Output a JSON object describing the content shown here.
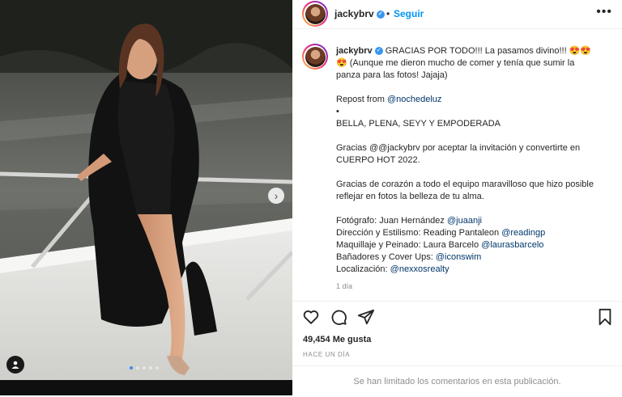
{
  "post": {
    "username": "jackybrv",
    "follow_label": "Seguir",
    "more_label": "•••",
    "verified_mark": "✓",
    "caption_lines": [
      "GRACIAS POR TODO!!! La pasamos divino!!! 😍😍",
      "😍 (Aunque me dieron mucho de comer y tenía que sumir la",
      "panza para las fotos! Jajaja)"
    ],
    "repost_prefix": "Repost from ",
    "repost_mention": "@nochedeluz",
    "bullet": "•",
    "tagline": "BELLA, PLENA, SEYY  Y EMPODERADA",
    "thanks_prefix": "Gracias @",
    "thanks_mention": "@jackybrv",
    "thanks_rest_1": " por aceptar la invitación y convertirte en",
    "thanks_rest_2": "CUERPO HOT 2022.",
    "team_line_1": "Gracias de corazón a todo el equipo maravilloso que hizo posible",
    "team_line_2": "reflejar en fotos la belleza de tu alma.",
    "credits": [
      {
        "label": "Fotógrafo: Juan Hernández ",
        "mention": "@juaanji"
      },
      {
        "label": "Dirección y Estilismo: Reading Pantaleon ",
        "mention": "@readingp"
      },
      {
        "label": "Maquillaje y Peinado: Laura Barcelo ",
        "mention": "@laurasbarcelo"
      },
      {
        "label": "Bañadores y Cover Ups: ",
        "mention": "@iconswim"
      },
      {
        "label": "Localización: ",
        "mention": "@nexxosrealty"
      }
    ],
    "time_short": "1 día",
    "likes": "49,454 Me gusta",
    "time_long": "HACE UN DÍA",
    "comments_limited": "Se han limitado los comentarios en esta publicación."
  },
  "carousel": {
    "next_glyph": "›",
    "dots_total": 5,
    "dots_active": 1
  },
  "icons": [
    "like-icon",
    "comment-icon",
    "share-icon",
    "save-icon",
    "tag-person-icon",
    "verified-badge-icon",
    "more-options-icon"
  ],
  "colors": {
    "accent": "#0095f6",
    "mention": "#00376b",
    "verified": "#3897f0",
    "muted": "#8e8e8e",
    "text": "#262626"
  }
}
